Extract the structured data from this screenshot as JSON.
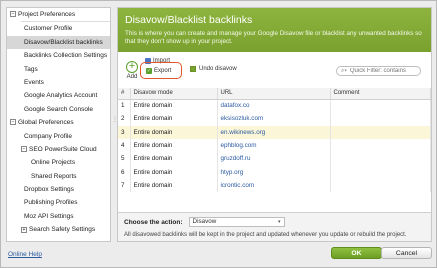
{
  "sidebar": {
    "project_prefs": "Project Preferences",
    "items": [
      {
        "label": "Customer Profile"
      },
      {
        "label": "Disavow/Blacklist backlinks"
      },
      {
        "label": "Backlinks Collection Settings"
      },
      {
        "label": "Tags"
      },
      {
        "label": "Events"
      },
      {
        "label": "Google Analytics Account"
      },
      {
        "label": "Google Search Console"
      }
    ],
    "global_prefs": "Global Preferences",
    "global_items": [
      {
        "label": "Company Profile"
      },
      {
        "label": "SEO PowerSuite Cloud"
      },
      {
        "label": "Online Projects"
      },
      {
        "label": "Shared Reports"
      },
      {
        "label": "Dropbox Settings"
      },
      {
        "label": "Publishing Profiles"
      },
      {
        "label": "Moz API Settings"
      },
      {
        "label": "Search Safety Settings"
      }
    ]
  },
  "header": {
    "title": "Disavow/Blacklist backlinks",
    "description": "This is where you can create and manage your Google Disavow file or blacklist any unwanted backlinks so that they don't show up in your project."
  },
  "toolbar": {
    "add": "Add",
    "import": "Import",
    "export": "Export",
    "undo": "Undo disavow",
    "filter_placeholder": "Quick Filter: contains"
  },
  "table": {
    "headers": [
      "#",
      "Disavow mode",
      "URL",
      "Comment"
    ],
    "rows": [
      {
        "num": "1",
        "mode": "Entire domain",
        "url": "datafox.co",
        "comment": ""
      },
      {
        "num": "2",
        "mode": "Entire domain",
        "url": "eksisozluk.com",
        "comment": ""
      },
      {
        "num": "3",
        "mode": "Entire domain",
        "url": "en.wikinews.org",
        "comment": ""
      },
      {
        "num": "4",
        "mode": "Entire domain",
        "url": "ephblog.com",
        "comment": ""
      },
      {
        "num": "5",
        "mode": "Entire domain",
        "url": "gruzdoff.ru",
        "comment": ""
      },
      {
        "num": "6",
        "mode": "Entire domain",
        "url": "htyp.org",
        "comment": ""
      },
      {
        "num": "7",
        "mode": "Entire domain",
        "url": "icrontic.com",
        "comment": ""
      }
    ]
  },
  "action": {
    "label": "Choose the action:",
    "selected": "Disavow",
    "note": "All disavowed backlinks will be kept in the project and updated whenever you update or rebuild the project."
  },
  "footer": {
    "help": "Online Help",
    "ok": "OK",
    "cancel": "Cancel"
  },
  "colors": {
    "header_green": "#7aa12e",
    "highlight_ring": "#e2572b",
    "selected_row": "#fcf6d8"
  }
}
